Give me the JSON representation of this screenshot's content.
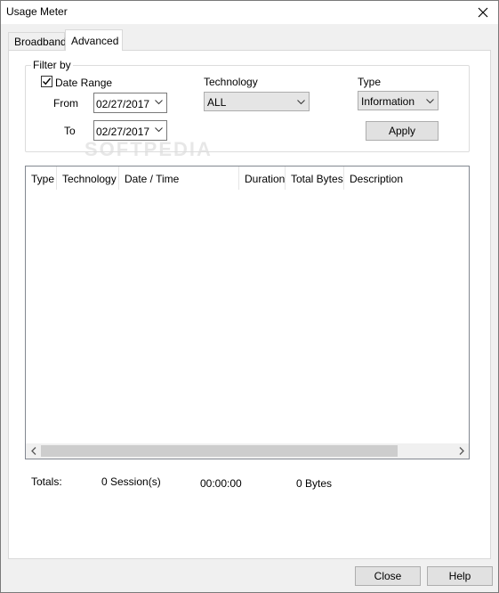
{
  "window": {
    "title": "Usage Meter"
  },
  "tabs": [
    {
      "label": "Broadband"
    },
    {
      "label": "Advanced"
    }
  ],
  "filter": {
    "group_label": "Filter by",
    "date_range_label": "Date Range",
    "date_range_checked": true,
    "from_label": "From",
    "from_value": "02/27/2017",
    "to_label": "To",
    "to_value": "02/27/2017",
    "technology_label": "Technology",
    "technology_value": "ALL",
    "type_label": "Type",
    "type_value": "Information",
    "apply_label": "Apply"
  },
  "table": {
    "columns": [
      "Type",
      "Technology",
      "Date / Time",
      "Duration",
      "Total Bytes",
      "Description"
    ],
    "rows": []
  },
  "totals": {
    "label": "Totals:",
    "sessions": "0 Session(s)",
    "duration": "00:00:00",
    "bytes": "0 Bytes"
  },
  "buttons": {
    "close_label": "Close",
    "help_label": "Help"
  },
  "watermark": "SOFTPEDIA"
}
